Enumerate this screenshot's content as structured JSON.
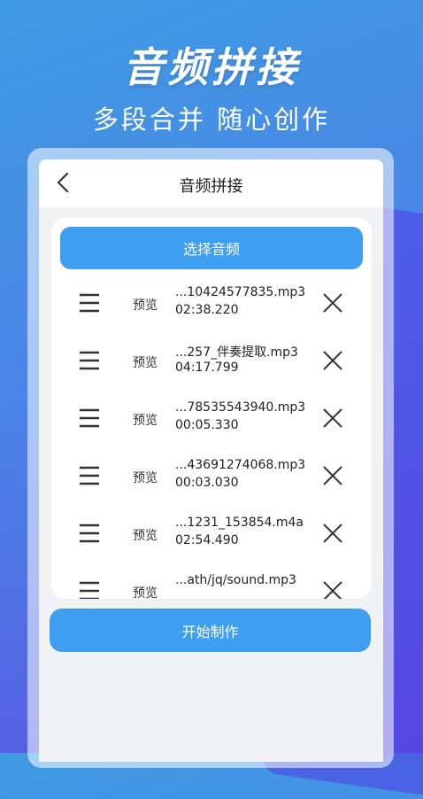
{
  "hero": {
    "title": "音频拼接",
    "subtitle": "多段合并  随心创作"
  },
  "app": {
    "title": "音频拼接",
    "back_icon": "chevron-left-icon",
    "select_button": "选择音频",
    "start_button": "开始制作",
    "preview_label": "预览",
    "files": [
      {
        "name": "...10424577835.mp3",
        "duration": "02:38.220"
      },
      {
        "name": "...257_伴奏提取.mp3",
        "duration": "04:17.799"
      },
      {
        "name": "...78535543940.mp3",
        "duration": "00:05.330"
      },
      {
        "name": "...43691274068.mp3",
        "duration": "00:03.030"
      },
      {
        "name": "...1231_153854.m4a",
        "duration": "02:54.490"
      },
      {
        "name": "...ath/jq/sound.mp3",
        "duration": ""
      }
    ]
  },
  "colors": {
    "accent": "#3e9ef0",
    "background_gradient_start": "#3f9be3",
    "background_gradient_end": "#5a52e4"
  }
}
